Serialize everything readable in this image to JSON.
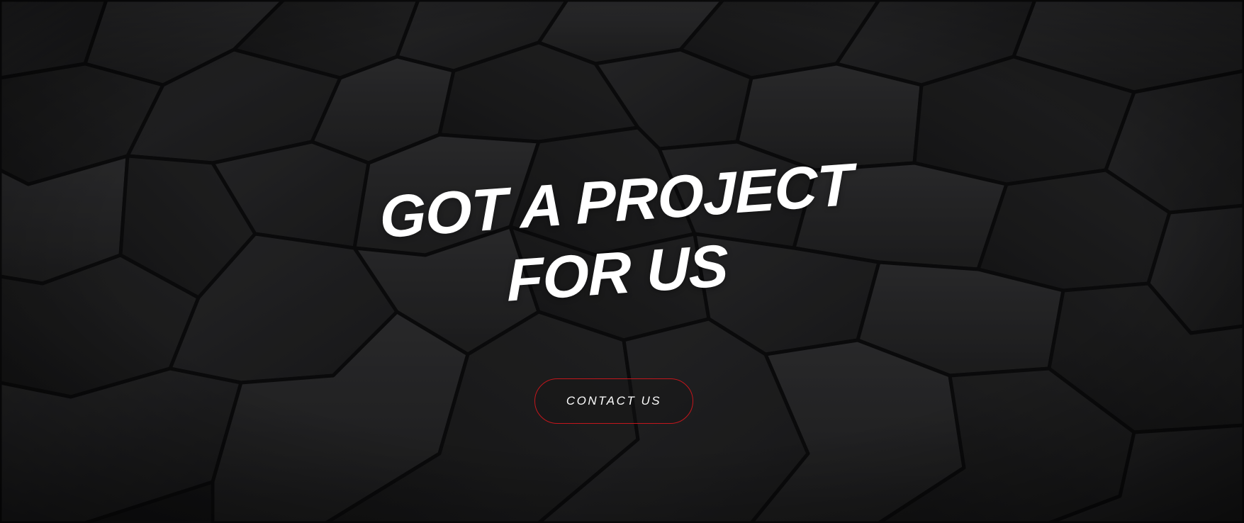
{
  "hero": {
    "headline_line1": "GOT A PROJECT",
    "headline_line2": "FOR US",
    "cta_label": "CONTACT US"
  },
  "colors": {
    "background": "#1c1c1d",
    "text": "#ffffff",
    "cta_border": "#c4161c"
  }
}
